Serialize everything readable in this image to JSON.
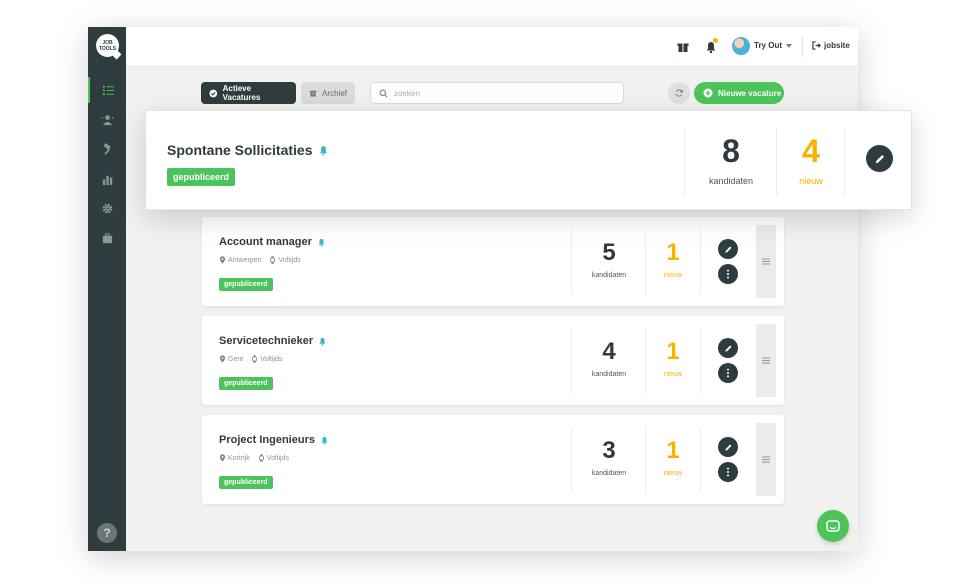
{
  "app": {
    "logo_text": "JOB TOOLS"
  },
  "colors": {
    "accent": "#4cc45b",
    "sidebar": "#2f3c3f",
    "highlight": "#f5b400"
  },
  "sidebar": {
    "items": [
      {
        "icon": "list-icon",
        "active": true
      },
      {
        "icon": "person-icon",
        "active": false
      },
      {
        "icon": "hammer-icon",
        "active": false
      },
      {
        "icon": "bar-chart-icon",
        "active": false
      },
      {
        "icon": "gear-icon",
        "active": false
      },
      {
        "icon": "briefcase-icon",
        "active": false
      }
    ],
    "help_label": "?"
  },
  "topbar": {
    "user_name": "Try Out",
    "exit_label": "jobsite"
  },
  "toolbar": {
    "active_label": "Actieve Vacatures",
    "archive_label": "Archief",
    "search_placeholder": "zoeken",
    "new_label": "Nieuwe vacature"
  },
  "featured": {
    "title": "Spontane Sollicitaties",
    "status": "gepubliceerd",
    "candidates": "8",
    "candidates_label": "kandidaten",
    "new": "4",
    "new_label": "nieuw"
  },
  "jobs": [
    {
      "title": "Account manager",
      "location": "Antwerpen",
      "hours": "Voltijds",
      "status": "gepubliceerd",
      "candidates": "5",
      "candidates_label": "kandidaten",
      "new": "1",
      "new_label": "nieuw"
    },
    {
      "title": "Servicetechnieker",
      "location": "Gent",
      "hours": "Voltijds",
      "status": "gepubliceerd",
      "candidates": "4",
      "candidates_label": "kandidaten",
      "new": "1",
      "new_label": "nieuw"
    },
    {
      "title": "Project Ingenieurs",
      "location": "Kortrijk",
      "hours": "Voltijds",
      "status": "gepubliceerd",
      "candidates": "3",
      "candidates_label": "kandidaten",
      "new": "1",
      "new_label": "nieuw"
    }
  ]
}
